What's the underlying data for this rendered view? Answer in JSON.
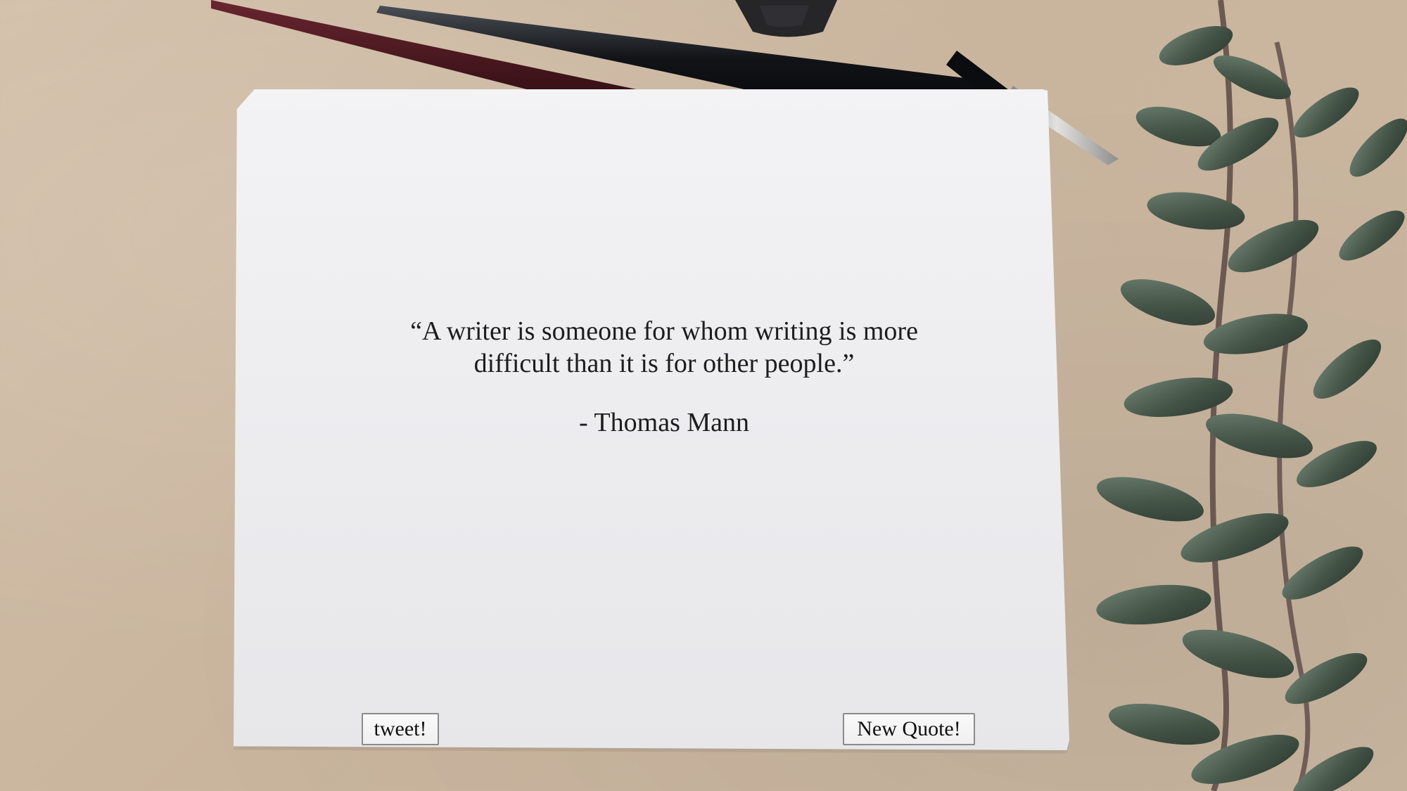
{
  "quote": {
    "text": "“A writer is someone for whom writing is more difficult than it is for other people.”",
    "author": "- Thomas Mann"
  },
  "buttons": {
    "tweet_label": "tweet!",
    "new_quote_label": "New Quote!"
  },
  "colors": {
    "background": "#cdb9a3",
    "paper": "#ececef",
    "text": "#1d1d1d"
  },
  "icons": [
    "dip-pen-icon",
    "eucalyptus-branch-icon",
    "ink-bottle-icon"
  ]
}
